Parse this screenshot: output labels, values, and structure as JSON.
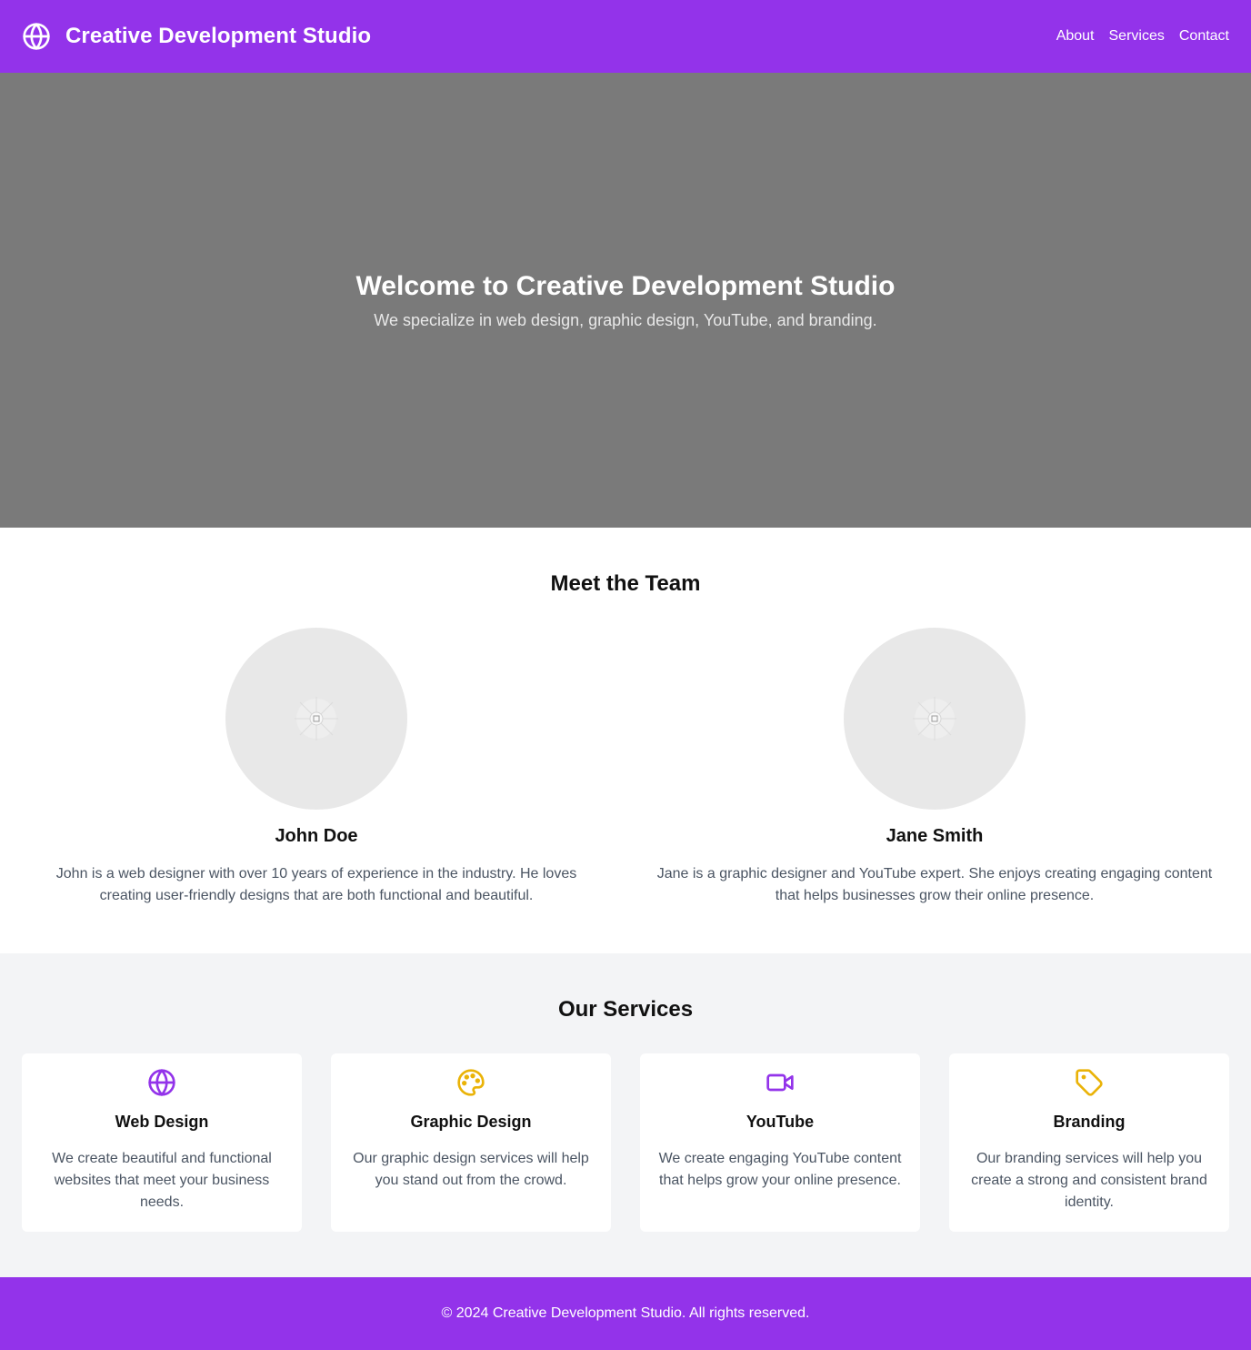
{
  "header": {
    "logo_icon": "globe-icon",
    "title": "Creative Development Studio",
    "nav": [
      "About",
      "Services",
      "Contact"
    ]
  },
  "hero": {
    "title": "Welcome to Creative Development Studio",
    "subtitle": "We specialize in web design, graphic design, YouTube, and branding."
  },
  "team": {
    "heading": "Meet the Team",
    "members": [
      {
        "name": "John Doe",
        "bio": "John is a web designer with over 10 years of experience in the industry. He loves creating user-friendly designs that are both functional and beautiful."
      },
      {
        "name": "Jane Smith",
        "bio": "Jane is a graphic designer and YouTube expert. She enjoys creating engaging content that helps businesses grow their online presence."
      }
    ]
  },
  "services": {
    "heading": "Our Services",
    "items": [
      {
        "icon": "globe-icon",
        "title": "Web Design",
        "description": "We create beautiful and functional websites that meet your business needs."
      },
      {
        "icon": "palette-icon",
        "title": "Graphic Design",
        "description": "Our graphic design services will help you stand out from the crowd."
      },
      {
        "icon": "video-icon",
        "title": "YouTube",
        "description": "We create engaging YouTube content that helps grow your online presence."
      },
      {
        "icon": "tag-icon",
        "title": "Branding",
        "description": "Our branding services will help you create a strong and consistent brand identity."
      }
    ]
  },
  "footer": {
    "text": "© 2024 Creative Development Studio. All rights reserved."
  },
  "colors": {
    "brand": "#9333ea",
    "hero_bg": "#7a7a7a",
    "accent_yellow": "#eab308",
    "muted_text": "#4b5563",
    "section_bg": "#f3f4f6"
  }
}
